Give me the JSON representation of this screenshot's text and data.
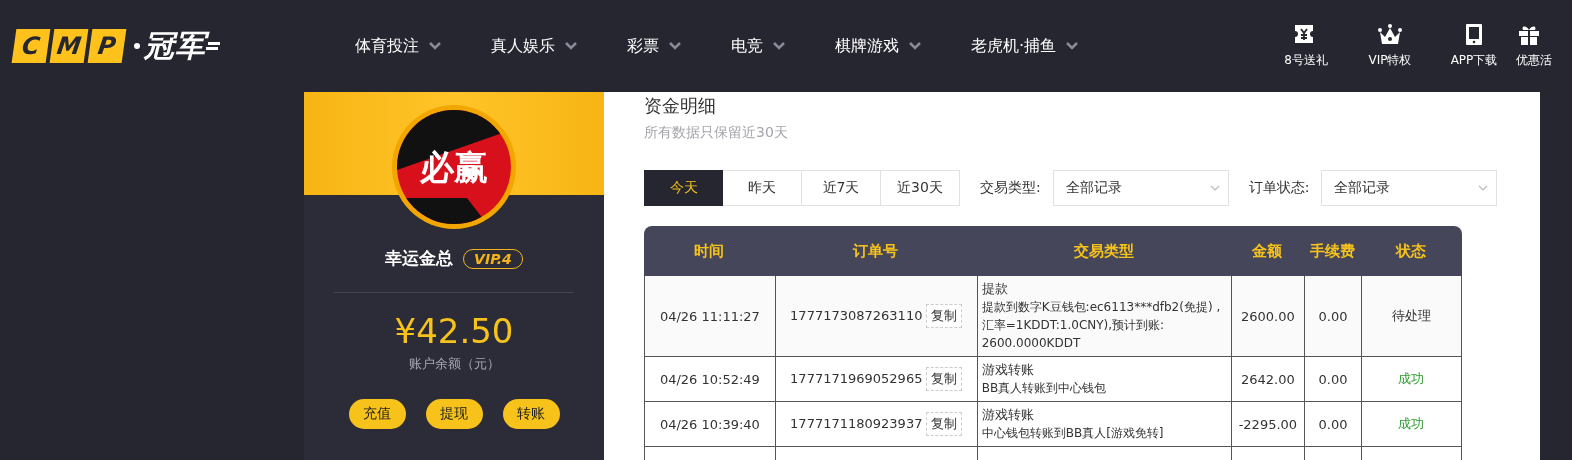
{
  "header": {
    "logo": {
      "letters": [
        "C",
        "M",
        "P"
      ],
      "name": "冠军"
    },
    "nav": [
      {
        "label": "体育投注"
      },
      {
        "label": "真人娱乐"
      },
      {
        "label": "彩票"
      },
      {
        "label": "电竞"
      },
      {
        "label": "棋牌游戏"
      },
      {
        "label": "老虎机·捕鱼"
      }
    ],
    "shortcuts": [
      {
        "kind": "ticket",
        "label": "8号送礼"
      },
      {
        "kind": "crown",
        "label": "VIP特权"
      },
      {
        "kind": "tablet",
        "label": "APP下载"
      },
      {
        "kind": "gift",
        "label": "优惠活"
      }
    ]
  },
  "profile": {
    "avatar_text": "必赢",
    "username": "幸运金总",
    "vip": "VIP.4",
    "balance": "¥42.50",
    "balance_label": "账户余额（元）",
    "actions": [
      "充值",
      "提现",
      "转账"
    ]
  },
  "funds": {
    "title": "资金明细",
    "subtitle": "所有数据只保留近30天",
    "ranges": [
      {
        "label": "今天",
        "selected": true
      },
      {
        "label": "昨天",
        "selected": false
      },
      {
        "label": "近7天",
        "selected": false
      },
      {
        "label": "近30天",
        "selected": false
      }
    ],
    "filters": [
      {
        "label": "交易类型:",
        "value": "全部记录"
      },
      {
        "label": "订单状态:",
        "value": "全部记录"
      }
    ],
    "table": {
      "columns": [
        "时间",
        "订单号",
        "交易类型",
        "金额",
        "手续费",
        "状态"
      ],
      "rows": [
        {
          "time": "04/26 11:11:27",
          "order": "1777173087263110",
          "copy": "复制",
          "type": "提款",
          "detail": "提款到数字K豆钱包:ec6113***dfb2(免提) ,汇率=1KDDT:1.0CNY),预计到账: 2600.0000KDDT",
          "amount": "2600.00",
          "fee": "0.00",
          "status": "待处理",
          "kind": "pending"
        },
        {
          "time": "04/26 10:52:49",
          "order": "1777171969052965",
          "copy": "复制",
          "type": "游戏转账",
          "detail": "BB真人转账到中心钱包",
          "amount": "2642.00",
          "fee": "0.00",
          "status": "成功",
          "kind": "success"
        },
        {
          "time": "04/26 10:39:40",
          "order": "1777171180923937",
          "copy": "复制",
          "type": "游戏转账",
          "detail": "中心钱包转账到BB真人[游戏免转]",
          "amount": "-2295.00",
          "fee": "0.00",
          "status": "成功",
          "kind": "success"
        }
      ]
    }
  }
}
